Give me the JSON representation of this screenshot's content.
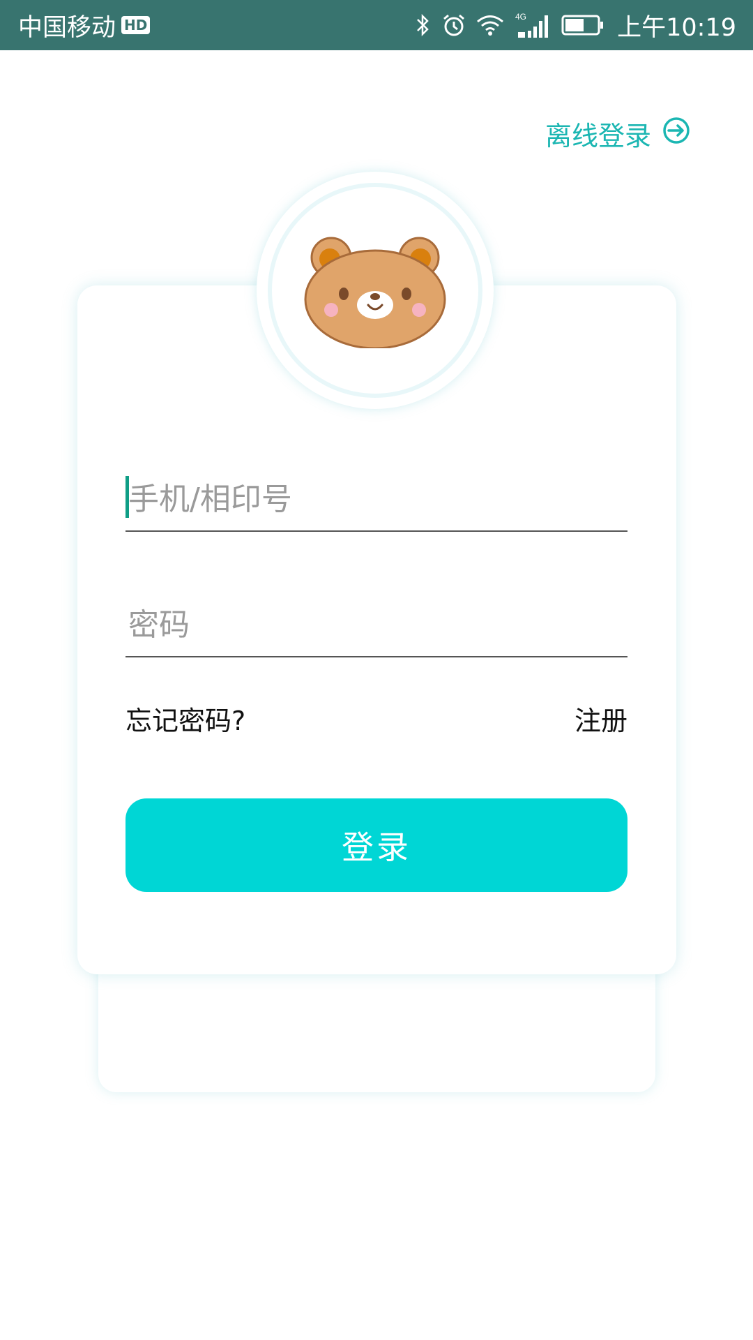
{
  "status_bar": {
    "carrier": "中国移动",
    "hd_badge": "HD",
    "network": "4G",
    "time": "上午10:19",
    "icons": [
      "bluetooth-icon",
      "alarm-icon",
      "wifi-icon",
      "signal-icon",
      "battery-icon"
    ]
  },
  "header": {
    "offline_login": "离线登录",
    "offline_icon": "arrow-circle-right-icon"
  },
  "avatar": {
    "icon": "bear-icon"
  },
  "form": {
    "phone_placeholder": "手机/相印号",
    "password_placeholder": "密码",
    "forgot_password": "忘记密码?",
    "register": "注册",
    "login_button": "登录"
  },
  "colors": {
    "status_bar": "#38746f",
    "accent": "#1bb6b2",
    "button": "#00d6d5",
    "caret": "#0f9e86"
  }
}
